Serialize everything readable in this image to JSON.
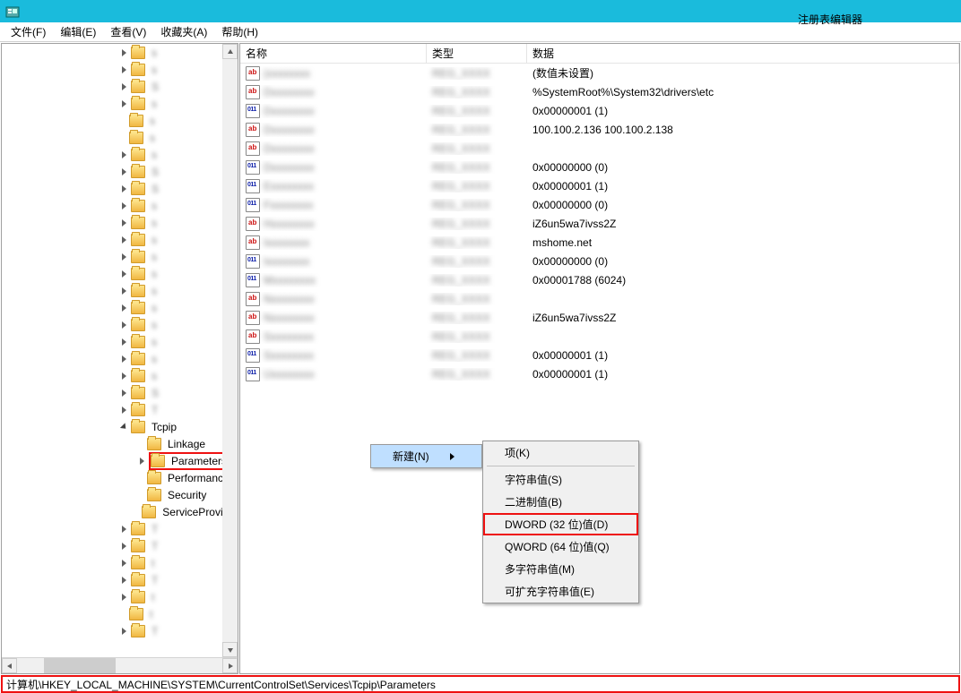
{
  "window": {
    "title": "注册表编辑器"
  },
  "menu": {
    "file": "文件(F)",
    "edit": "编辑(E)",
    "view": "查看(V)",
    "favorites": "收藏夹(A)",
    "help": "帮助(H)"
  },
  "tree": {
    "items": [
      {
        "label": "s",
        "blur": true,
        "indent": 130,
        "exp": "col"
      },
      {
        "label": "s",
        "blur": true,
        "indent": 130,
        "exp": "col"
      },
      {
        "label": "S",
        "blur": true,
        "indent": 130,
        "exp": "col"
      },
      {
        "label": "s",
        "blur": true,
        "indent": 130,
        "exp": "col"
      },
      {
        "label": "s",
        "blur": true,
        "indent": 130,
        "exp": ""
      },
      {
        "label": "s",
        "blur": true,
        "indent": 130,
        "exp": ""
      },
      {
        "label": "s",
        "blur": true,
        "indent": 130,
        "exp": "col"
      },
      {
        "label": "S",
        "blur": true,
        "indent": 130,
        "exp": "col"
      },
      {
        "label": "S",
        "blur": true,
        "indent": 130,
        "exp": "col"
      },
      {
        "label": "s",
        "blur": true,
        "indent": 130,
        "exp": "col"
      },
      {
        "label": "s",
        "blur": true,
        "indent": 130,
        "exp": "col"
      },
      {
        "label": "s",
        "blur": true,
        "indent": 130,
        "exp": "col"
      },
      {
        "label": "s",
        "blur": true,
        "indent": 130,
        "exp": "col"
      },
      {
        "label": "s",
        "blur": true,
        "indent": 130,
        "exp": "col"
      },
      {
        "label": "s",
        "blur": true,
        "indent": 130,
        "exp": "col"
      },
      {
        "label": "s",
        "blur": true,
        "indent": 130,
        "exp": "col"
      },
      {
        "label": "s",
        "blur": true,
        "indent": 130,
        "exp": "col"
      },
      {
        "label": "s",
        "blur": true,
        "indent": 130,
        "exp": "col"
      },
      {
        "label": "s",
        "blur": true,
        "indent": 130,
        "exp": "col"
      },
      {
        "label": "s",
        "blur": true,
        "indent": 130,
        "exp": "col"
      },
      {
        "label": "S",
        "blur": true,
        "indent": 130,
        "exp": "col"
      },
      {
        "label": "T",
        "blur": true,
        "indent": 130,
        "exp": "col"
      },
      {
        "label": "Tcpip",
        "blur": false,
        "indent": 130,
        "exp": "exp"
      },
      {
        "label": "Linkage",
        "blur": false,
        "indent": 150,
        "exp": ""
      },
      {
        "label": "Parameters",
        "blur": false,
        "indent": 150,
        "exp": "col",
        "highlight": true
      },
      {
        "label": "Performance",
        "blur": false,
        "indent": 150,
        "exp": ""
      },
      {
        "label": "Security",
        "blur": false,
        "indent": 150,
        "exp": ""
      },
      {
        "label": "ServiceProvide",
        "blur": false,
        "indent": 150,
        "exp": ""
      },
      {
        "label": "T",
        "blur": true,
        "indent": 130,
        "exp": "col"
      },
      {
        "label": "T",
        "blur": true,
        "indent": 130,
        "exp": "col"
      },
      {
        "label": "t",
        "blur": true,
        "indent": 130,
        "exp": "col"
      },
      {
        "label": "T",
        "blur": true,
        "indent": 130,
        "exp": "col"
      },
      {
        "label": "t",
        "blur": true,
        "indent": 130,
        "exp": "col"
      },
      {
        "label": "t",
        "blur": true,
        "indent": 130,
        "exp": ""
      },
      {
        "label": "T",
        "blur": true,
        "indent": 130,
        "exp": "col"
      }
    ]
  },
  "list": {
    "headers": {
      "name": "名称",
      "type": "类型",
      "data": "数据"
    },
    "rows": [
      {
        "icon": "str",
        "name": "(",
        "blur": true,
        "data": "(数值未设置)"
      },
      {
        "icon": "str",
        "name": "D",
        "blur": true,
        "data": "%SystemRoot%\\System32\\drivers\\etc"
      },
      {
        "icon": "num",
        "name": "D",
        "blur": true,
        "data": "0x00000001 (1)"
      },
      {
        "icon": "str",
        "name": "D",
        "blur": true,
        "data": "100.100.2.136 100.100.2.138"
      },
      {
        "icon": "str",
        "name": "D",
        "blur": true,
        "data": ""
      },
      {
        "icon": "num",
        "name": "D",
        "blur": true,
        "data": "0x00000000 (0)"
      },
      {
        "icon": "num",
        "name": "E",
        "blur": true,
        "data": "0x00000001 (1)"
      },
      {
        "icon": "num",
        "name": "F",
        "blur": true,
        "data": "0x00000000 (0)"
      },
      {
        "icon": "str",
        "name": "H",
        "blur": true,
        "data": "iZ6un5wa7ivss2Z"
      },
      {
        "icon": "str",
        "name": "I",
        "blur": true,
        "data": "mshome.net"
      },
      {
        "icon": "num",
        "name": "I",
        "blur": true,
        "data": "0x00000000 (0)"
      },
      {
        "icon": "num",
        "name": "M",
        "blur": true,
        "data": "0x00001788 (6024)"
      },
      {
        "icon": "str",
        "name": "N",
        "blur": true,
        "data": ""
      },
      {
        "icon": "str",
        "name": "N",
        "blur": true,
        "data": "iZ6un5wa7ivss2Z"
      },
      {
        "icon": "str",
        "name": "S",
        "blur": true,
        "data": ""
      },
      {
        "icon": "num",
        "name": "S",
        "blur": true,
        "data": "0x00000001 (1)"
      },
      {
        "icon": "num",
        "name": "U",
        "blur": true,
        "data": "0x00000001 (1)"
      }
    ]
  },
  "context_menu": {
    "parent": {
      "new": "新建(N)"
    },
    "sub": {
      "key": "项(K)",
      "string": "字符串值(S)",
      "binary": "二进制值(B)",
      "dword": "DWORD (32 位)值(D)",
      "qword": "QWORD (64 位)值(Q)",
      "multistring": "多字符串值(M)",
      "expandstring": "可扩充字符串值(E)"
    }
  },
  "statusbar": {
    "path": "计算机\\HKEY_LOCAL_MACHINE\\SYSTEM\\CurrentControlSet\\Services\\Tcpip\\Parameters"
  }
}
